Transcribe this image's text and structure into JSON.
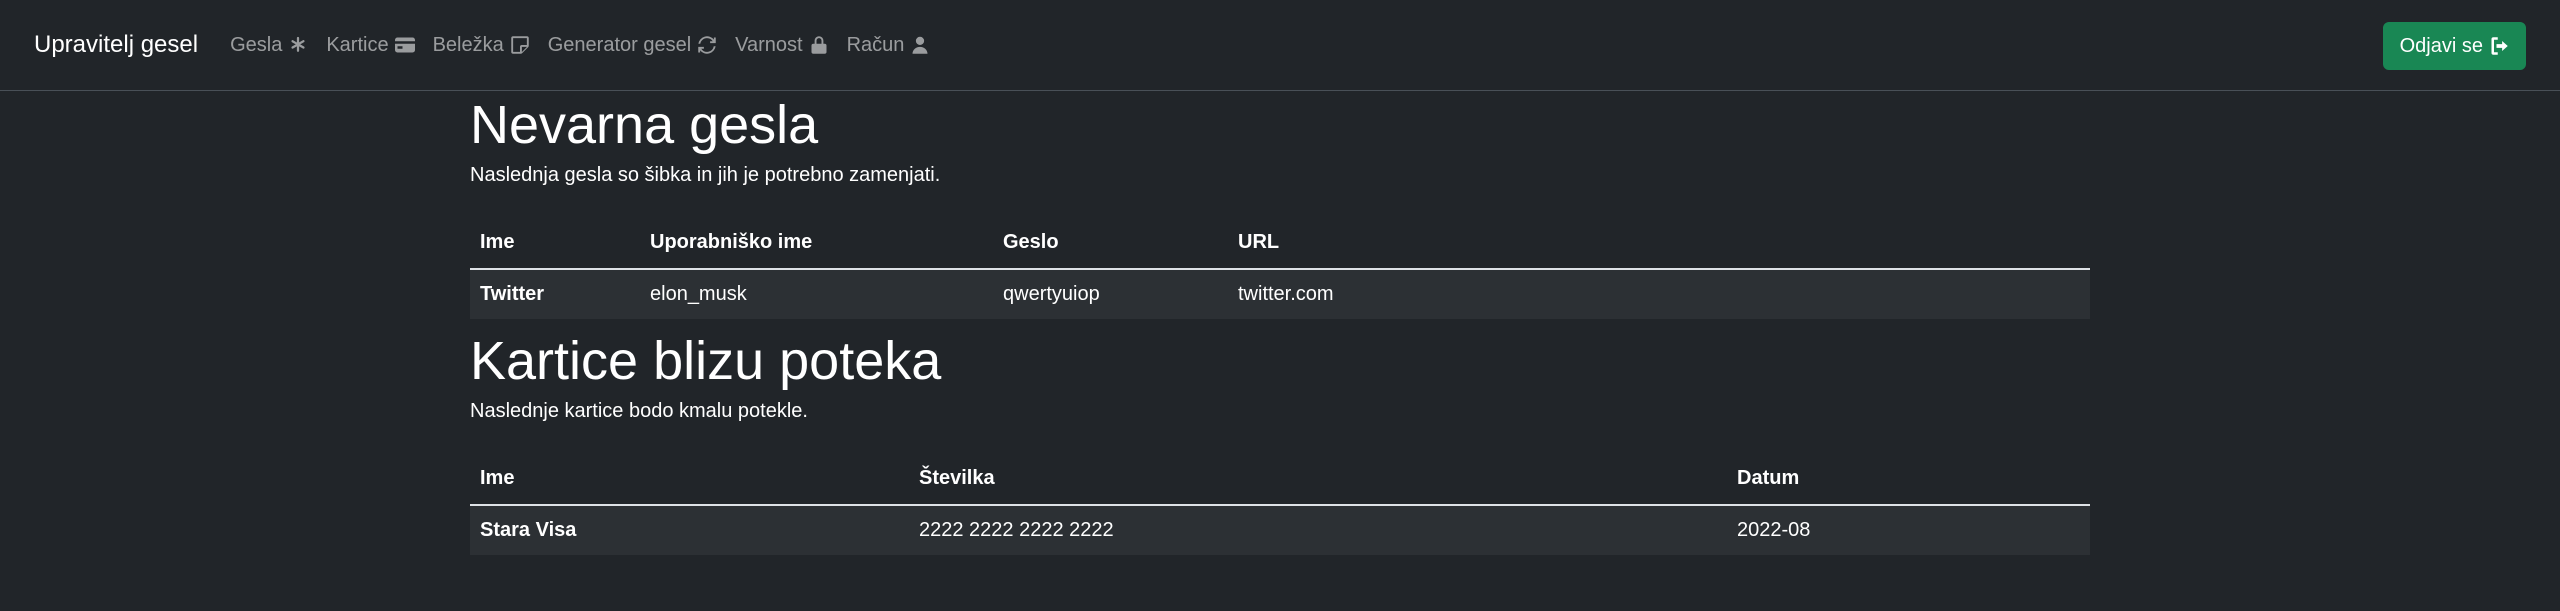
{
  "navbar": {
    "brand": "Upravitelj gesel",
    "links": [
      {
        "label": "Gesla",
        "icon": "asterisk-icon"
      },
      {
        "label": "Kartice",
        "icon": "credit-card-icon"
      },
      {
        "label": "Beležka",
        "icon": "sticky-note-icon"
      },
      {
        "label": "Generator gesel",
        "icon": "refresh-icon"
      },
      {
        "label": "Varnost",
        "icon": "lock-icon"
      },
      {
        "label": "Račun",
        "icon": "user-icon"
      }
    ],
    "logout_label": "Odjavi se",
    "logout_icon": "sign-out-icon",
    "logout_color": "#198754"
  },
  "weak_passwords": {
    "title": "Nevarna gesla",
    "description": "Naslednja gesla so šibka in jih je potrebno zamenjati.",
    "columns": [
      "Ime",
      "Uporabniško ime",
      "Geslo",
      "URL"
    ],
    "rows": [
      [
        "Twitter",
        "elon_musk",
        "qwertyuiop",
        "twitter.com"
      ]
    ]
  },
  "expiring_cards": {
    "title": "Kartice blizu poteka",
    "description": "Naslednje kartice bodo kmalu potekle.",
    "columns": [
      "Ime",
      "Številka",
      "Datum"
    ],
    "rows": [
      [
        "Stara Visa",
        "2222 2222 2222 2222",
        "2022-08"
      ]
    ]
  }
}
